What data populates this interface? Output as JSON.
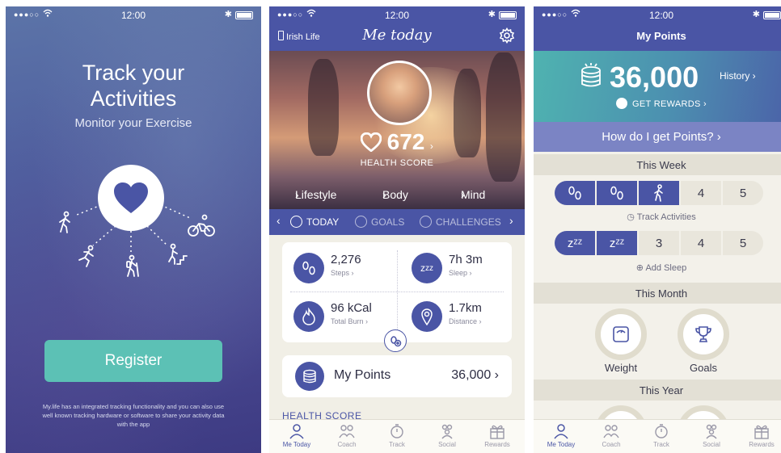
{
  "status": {
    "time": "12:00"
  },
  "screen1": {
    "title_line1": "Track your",
    "title_line2": "Activities",
    "subtitle": "Monitor your Exercise",
    "register_label": "Register",
    "disclaimer": "My.life has an integrated tracking functionality and you can also use well known tracking hardware or software to share your activity data with the app"
  },
  "screen2": {
    "brand": "Irish Life",
    "app_title": "Me today",
    "health_score": "672",
    "health_score_label": "HEALTH SCORE",
    "hero_links": [
      "Lifestyle",
      "Body",
      "Mind"
    ],
    "tabs": [
      {
        "label": "TODAY",
        "active": true
      },
      {
        "label": "GOALS",
        "active": false
      },
      {
        "label": "CHALLENGES",
        "active": false
      }
    ],
    "stats": [
      {
        "value": "2,276",
        "label": "Steps",
        "icon": "footprints-icon"
      },
      {
        "value": "7h 3m",
        "label": "Sleep",
        "icon": "sleep-icon"
      },
      {
        "value": "96 kCal",
        "label": "Total Burn",
        "icon": "flame-icon"
      },
      {
        "value": "1.7km",
        "label": "Distance",
        "icon": "location-pin-icon"
      }
    ],
    "points_label": "My Points",
    "points_value": "36,000",
    "section_health_score": "HEALTH SCORE"
  },
  "screen3": {
    "page_title": "My Points",
    "points_value": "36,000",
    "history_label": "History",
    "get_rewards_label": "GET REWARDS",
    "how_label": "How do I get Points?",
    "this_week_label": "This Week",
    "activity_days": [
      {
        "label": "",
        "done": true,
        "icon": "footprints-icon"
      },
      {
        "label": "",
        "done": true,
        "icon": "footprints-icon"
      },
      {
        "label": "",
        "done": true,
        "icon": "walking-icon"
      },
      {
        "label": "4",
        "done": false
      },
      {
        "label": "5",
        "done": false
      }
    ],
    "track_activities_label": "Track Activities",
    "sleep_days": [
      {
        "label": "zᶻᶻ",
        "done": true
      },
      {
        "label": "zᶻᶻ",
        "done": true
      },
      {
        "label": "3",
        "done": false
      },
      {
        "label": "4",
        "done": false
      },
      {
        "label": "5",
        "done": false
      }
    ],
    "add_sleep_label": "Add Sleep",
    "this_month_label": "This Month",
    "month_badges": [
      "Weight",
      "Goals"
    ],
    "this_year_label": "This Year"
  },
  "bottom_nav": [
    "Me Today",
    "Coach",
    "Track",
    "Social",
    "Rewards"
  ],
  "colors": {
    "brand": "#4a55a5",
    "teal": "#5cc1b5",
    "background": "#f1efe6"
  }
}
